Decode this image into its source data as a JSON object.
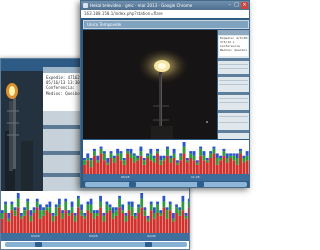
{
  "front_window": {
    "title": "Hekal.televideo - gmc - mar 2013 - Google Chrome",
    "url": "163.188.158.1/index.php?station=flare",
    "header": "Unico Tempovide",
    "info_lines": [
      "Expedie: 4/5/2013 x",
      "3/5/14 x",
      "Conferencia",
      "Medios: Queibol"
    ],
    "timeline_labels": [
      "05/25",
      "11:25"
    ]
  },
  "back_window": {
    "info_lines": [
      "Expedie: 47162/0823",
      "05/16/13 13:30:18",
      "Conferencia:",
      "Medios: Queibol, Queibol"
    ],
    "timeline_labels": [
      "03/20",
      "04/25",
      "04/45"
    ]
  },
  "colors": {
    "app_blue": "#2f5a82",
    "chart_red": "#d2322d",
    "chart_green": "#2e9b3a",
    "chart_blue": "#2a55c8",
    "flame": "#f2e39a"
  },
  "chart_data": [
    {
      "type": "bar",
      "title": "",
      "series": [
        {
          "values": [
            4,
            6,
            3,
            8,
            5,
            9,
            6,
            4,
            7,
            5,
            8,
            6,
            4,
            9,
            7,
            5,
            6,
            8,
            4,
            7,
            6,
            5,
            9,
            4,
            6,
            8,
            5,
            7,
            4,
            6,
            9,
            5,
            7,
            6,
            4,
            8,
            6,
            5,
            7,
            9,
            4,
            6,
            8,
            5,
            7,
            6,
            4,
            9,
            5,
            6
          ]
        },
        {
          "values": [
            2,
            1,
            3,
            2,
            1,
            2,
            3,
            1,
            2,
            2,
            1,
            3,
            2,
            1,
            2,
            3,
            1,
            2,
            2,
            1,
            3,
            2,
            1,
            2,
            1,
            3,
            2,
            2,
            1,
            2,
            3,
            1,
            2,
            2,
            1,
            3,
            2,
            1,
            2,
            2,
            3,
            1,
            2,
            2,
            1,
            2,
            3,
            1,
            2,
            2
          ]
        },
        {
          "values": [
            1,
            2,
            1,
            1,
            2,
            1,
            1,
            2,
            1,
            1,
            2,
            1,
            1,
            1,
            2,
            1,
            1,
            2,
            1,
            1,
            2,
            1,
            1,
            2,
            1,
            1,
            1,
            2,
            1,
            1,
            2,
            1,
            1,
            2,
            1,
            1,
            2,
            1,
            1,
            1,
            2,
            1,
            1,
            2,
            1,
            1,
            2,
            1,
            1,
            2
          ]
        }
      ]
    },
    {
      "type": "bar",
      "title": "",
      "series": [
        {
          "values": [
            5,
            7,
            4,
            8,
            6,
            9,
            5,
            6,
            8,
            4,
            7,
            9,
            5,
            6,
            8,
            7,
            4,
            6,
            9,
            5,
            8,
            6,
            7,
            4,
            9,
            6,
            5,
            8,
            7,
            5,
            6,
            9,
            4,
            7,
            8,
            5,
            6,
            9,
            7,
            4,
            8,
            6,
            5,
            7,
            9,
            6,
            4,
            8,
            5,
            7,
            6,
            9,
            5,
            8,
            4,
            7,
            6,
            8,
            5,
            9
          ]
        },
        {
          "values": [
            2,
            3,
            1,
            2,
            2,
            3,
            1,
            2,
            3,
            2,
            1,
            2,
            3,
            2,
            1,
            2,
            2,
            3,
            1,
            2,
            3,
            1,
            2,
            2,
            3,
            2,
            1,
            2,
            3,
            2,
            1,
            2,
            2,
            3,
            1,
            2,
            2,
            3,
            1,
            2,
            2,
            3,
            1,
            2,
            3,
            2,
            1,
            2,
            2,
            3,
            1,
            2,
            3,
            2,
            1,
            2,
            2,
            3,
            1,
            2
          ]
        },
        {
          "values": [
            1,
            1,
            2,
            1,
            1,
            2,
            1,
            1,
            1,
            2,
            1,
            1,
            2,
            1,
            1,
            2,
            1,
            1,
            2,
            1,
            1,
            1,
            2,
            1,
            1,
            2,
            1,
            1,
            2,
            1,
            1,
            2,
            1,
            1,
            1,
            2,
            1,
            1,
            2,
            1,
            1,
            2,
            1,
            1,
            2,
            1,
            1,
            1,
            2,
            1,
            1,
            2,
            1,
            1,
            2,
            1,
            1,
            2,
            1,
            1
          ]
        }
      ]
    }
  ]
}
